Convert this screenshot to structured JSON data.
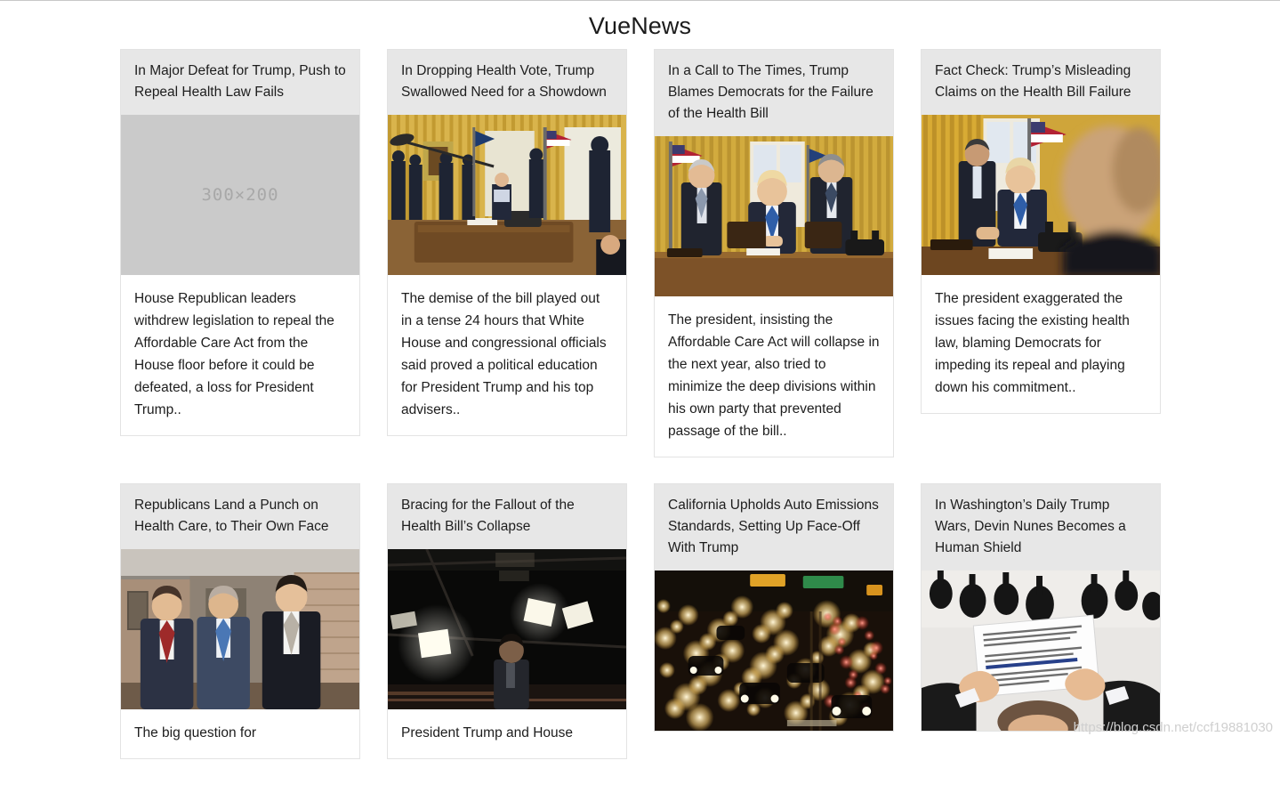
{
  "header": {
    "title": "VueNews"
  },
  "placeholder": {
    "label": "300×200"
  },
  "watermark": {
    "text": "https://blog.csdn.net/ccf19881030"
  },
  "articles": [
    {
      "title": "In Major Defeat for Trump, Push to Repeal Health Law Fails",
      "description": "House Republican leaders withdrew legislation to repeal the Affordable Care Act from the House floor before it could be defeated, a loss for President Trump..",
      "image_type": "placeholder",
      "image_alt": "300×200 placeholder"
    },
    {
      "title": "In Dropping Health Vote, Trump Swallowed Need for a Showdown",
      "description": "The demise of the bill played out in a tense 24 hours that White House and congressional officials said proved a political education for President Trump and his top advisers..",
      "image_type": "photo",
      "image_alt": "Oval Office with press corps and officials around the Resolute desk"
    },
    {
      "title": "In a Call to The Times, Trump Blames Democrats for the Failure of the Health Bill",
      "description": "The president, insisting the Affordable Care Act will collapse in the next year, also tried to minimize the deep divisions within his own party that prevented passage of the bill..",
      "image_type": "photo",
      "image_alt": "President seated at the Resolute desk flanked by two officials"
    },
    {
      "title": "Fact Check: Trump’s Misleading Claims on the Health Bill Failure",
      "description": "The president exaggerated the issues facing the existing health law, blaming Democrats for impeding its repeal and playing down his commitment..",
      "image_type": "photo",
      "image_alt": "President at desk with an out-of-focus figure in the foreground"
    },
    {
      "title": "Republicans Land a Punch on Health Care, to Their Own Face",
      "description": "The big question for",
      "image_type": "photo",
      "image_alt": "Three men in suits walking down a Capitol corridor"
    },
    {
      "title": "Bracing for the Fallout of the Health Bill’s Collapse",
      "description": "President Trump and House",
      "image_type": "photo",
      "image_alt": "A man in a dark room lit by studio lights"
    },
    {
      "title": "California Upholds Auto Emissions Standards, Setting Up Face-Off With Trump",
      "description": "",
      "image_type": "photo",
      "image_alt": "Night freeway traffic with headlights and taillights"
    },
    {
      "title": "In Washington’s Daily Trump Wars, Devin Nunes Becomes a Human Shield",
      "description": "",
      "image_type": "photo",
      "image_alt": "Overhead view of hands holding a printed statement surrounded by microphones"
    }
  ]
}
